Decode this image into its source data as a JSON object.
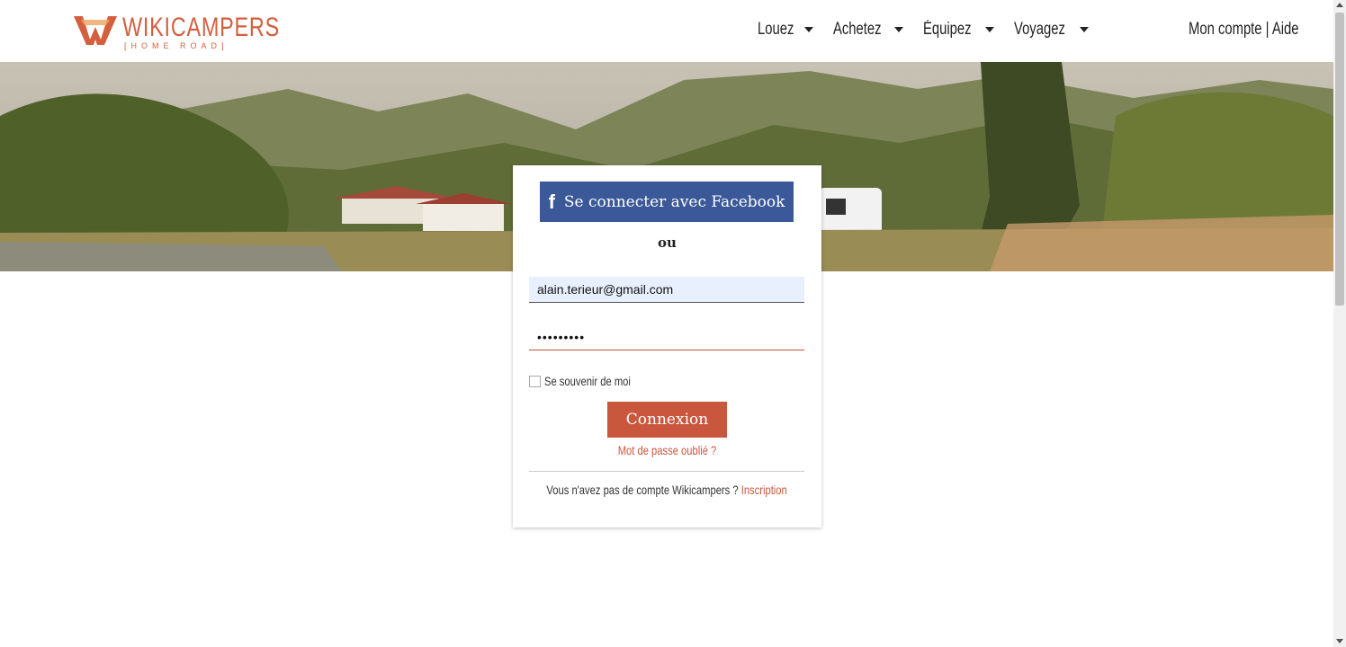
{
  "header": {
    "logo": {
      "name": "WIKICAMPERS",
      "tagline": "[HOME ROAD]"
    },
    "nav": [
      {
        "label": "Louez"
      },
      {
        "label": "Achetez"
      },
      {
        "label": "Équipez"
      },
      {
        "label": "Voyagez"
      }
    ],
    "account": {
      "my_account": "Mon compte",
      "separator": " | ",
      "help": "Aide"
    }
  },
  "login": {
    "facebook_label": "Se connecter avec Facebook",
    "or_label": "ou",
    "email_value": "alain.terieur@gmail.com",
    "password_value": "•••••••••",
    "remember_label": "Se souvenir de moi",
    "submit_label": "Connexion",
    "forgot_label": "Mot de passe oublié ?",
    "no_account_text": "Vous n'avez pas de compte Wikicampers ? ",
    "signup_label": "Inscription"
  },
  "colors": {
    "brand": "#d35f3f",
    "facebook": "#3b5998",
    "button": "#c9573e"
  },
  "icons": [
    "wikicampers-logo-icon",
    "facebook-icon",
    "caret-down-icon"
  ]
}
